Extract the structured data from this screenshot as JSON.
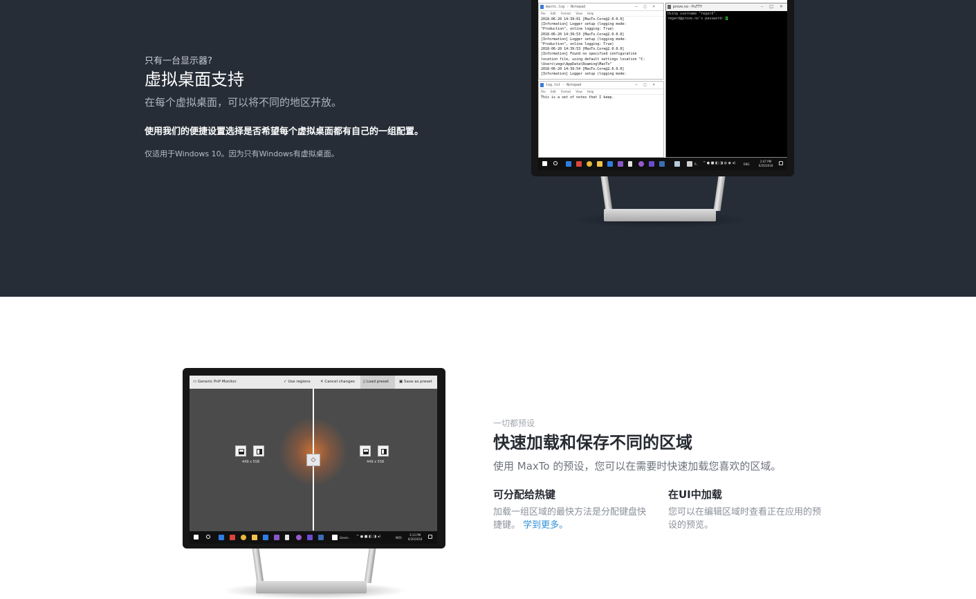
{
  "virtual_desktops": {
    "eyebrow": "只有一台显示器?",
    "title": "虚拟桌面支持",
    "lead": "在每个虚拟桌面，可以将不同的地区开放。",
    "emphasis": "使用我们的便捷设置选择是否希望每个虚拟桌面都有自己的一组配置。",
    "note": "仅适用于Windows 10。因为只有Windows有虚拟桌面。"
  },
  "monitor1": {
    "log_window": {
      "title": "maxto.log - Notepad",
      "menu": "File Edit Format View Help",
      "lines": [
        "2018-06-20 14:39:01 [MaxTo.Core@2.0.0.0]",
        "[Information] Logger setup (logging mode:",
        "\"Production\", online logging: True)",
        "2018-06-20 14:39:53 [MaxTo.Core@2.0.0.0]",
        "[Information] Logger setup (logging mode:",
        "\"Production\", online logging: True)",
        "2018-06-20 14:39:53 [MaxTo.Core@2.0.0.0]",
        "[Information] Found no specified configuration",
        "location file, using default settings location \"C:",
        "\\Users\\vego\\AppData\\Roaming\\MaxTo\"",
        "2018-06-20 14:39:54 [MaxTo.Core@2.0.0.0]",
        "[Information] Logger setup (logging mode:"
      ]
    },
    "notes_window": {
      "title": "log.txt - Notepad",
      "menu": "File Edit Format View Help",
      "text": "This is a set of notes that I keep."
    },
    "putty_window": {
      "title": "prove.no - PuTTY",
      "line1": "Using username \"regard\".",
      "line2": "regard@prove.no's password: "
    },
    "taskbar": {
      "time": "2:47 PM",
      "date": "6/20/2018",
      "lang": "ENG",
      "putty_label": "P..."
    }
  },
  "monitor2": {
    "toolbar": {
      "monitor_name": "Generic PnP Monitor",
      "use_regions": "Use regions",
      "cancel_changes": "Cancel changes",
      "load_preset": "Load preset",
      "save_as_preset": "Save as preset"
    },
    "left_zone_size": "449 x 558",
    "right_zone_size": "449 x 558",
    "taskbar": {
      "time": "3:13 PM",
      "date": "6/20/2018",
      "lang": "NOS",
      "app_label": "Gener..."
    }
  },
  "presets": {
    "eyebrow": "一切都预设",
    "title": "快速加载和保存不同的区域",
    "lead": "使用 MaxTo 的预设，您可以在需要时快速加载您喜欢的区域。",
    "feature1": {
      "title": "可分配给热键",
      "body": "加载一组区域的最快方法是分配键盘快捷键。",
      "link": "学到更多。"
    },
    "feature2": {
      "title": "在UI中加载",
      "body": "您可以在编辑区域时查看正在应用的预设的预览。"
    }
  },
  "colors": {
    "dark_bg": "#262d37",
    "link": "#2f8fd6",
    "glow": "#e07830"
  }
}
